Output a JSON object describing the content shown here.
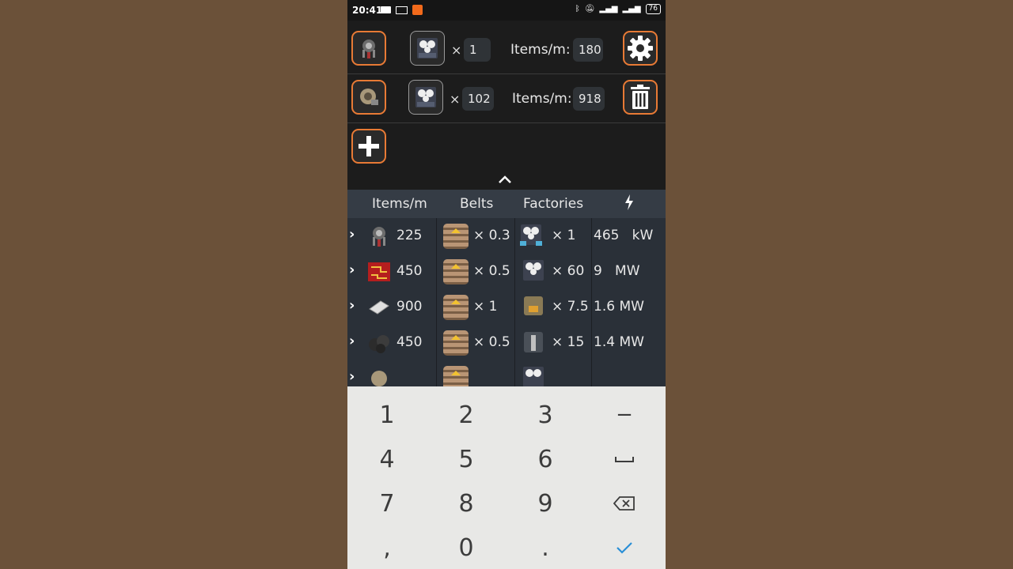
{
  "status": {
    "time": "20:41",
    "battery": "76"
  },
  "config": {
    "rows": [
      {
        "times": "×",
        "count": "1",
        "items_label": "Items/m:",
        "items_value": "180",
        "action_icon": "gear-icon"
      },
      {
        "times": "×",
        "count": "102",
        "items_label": "Items/m:",
        "items_value": "918",
        "action_icon": "trash-icon"
      }
    ],
    "add_icon": "plus-icon"
  },
  "table": {
    "headers": [
      "Items/m",
      "Belts",
      "Factories"
    ],
    "rows": [
      {
        "items": "225",
        "belts": "× 0.3",
        "factories": "× 1",
        "power": "465   kW"
      },
      {
        "items": "450",
        "belts": "× 0.5",
        "factories": "× 60",
        "power": "9   MW"
      },
      {
        "items": "900",
        "belts": "× 1",
        "factories": "× 7.5",
        "power": "1.6 MW"
      },
      {
        "items": "450",
        "belts": "× 0.5",
        "factories": "× 15",
        "power": "1.4 MW"
      }
    ]
  },
  "keypad": {
    "keys": [
      "1",
      "2",
      "3",
      "−",
      "4",
      "5",
      "6",
      "␣",
      "7",
      "8",
      "9",
      "⌫",
      ",",
      "0",
      ".",
      "✓"
    ]
  },
  "colors": {
    "accent": "#e87a35",
    "confirm": "#2a8fd6"
  }
}
